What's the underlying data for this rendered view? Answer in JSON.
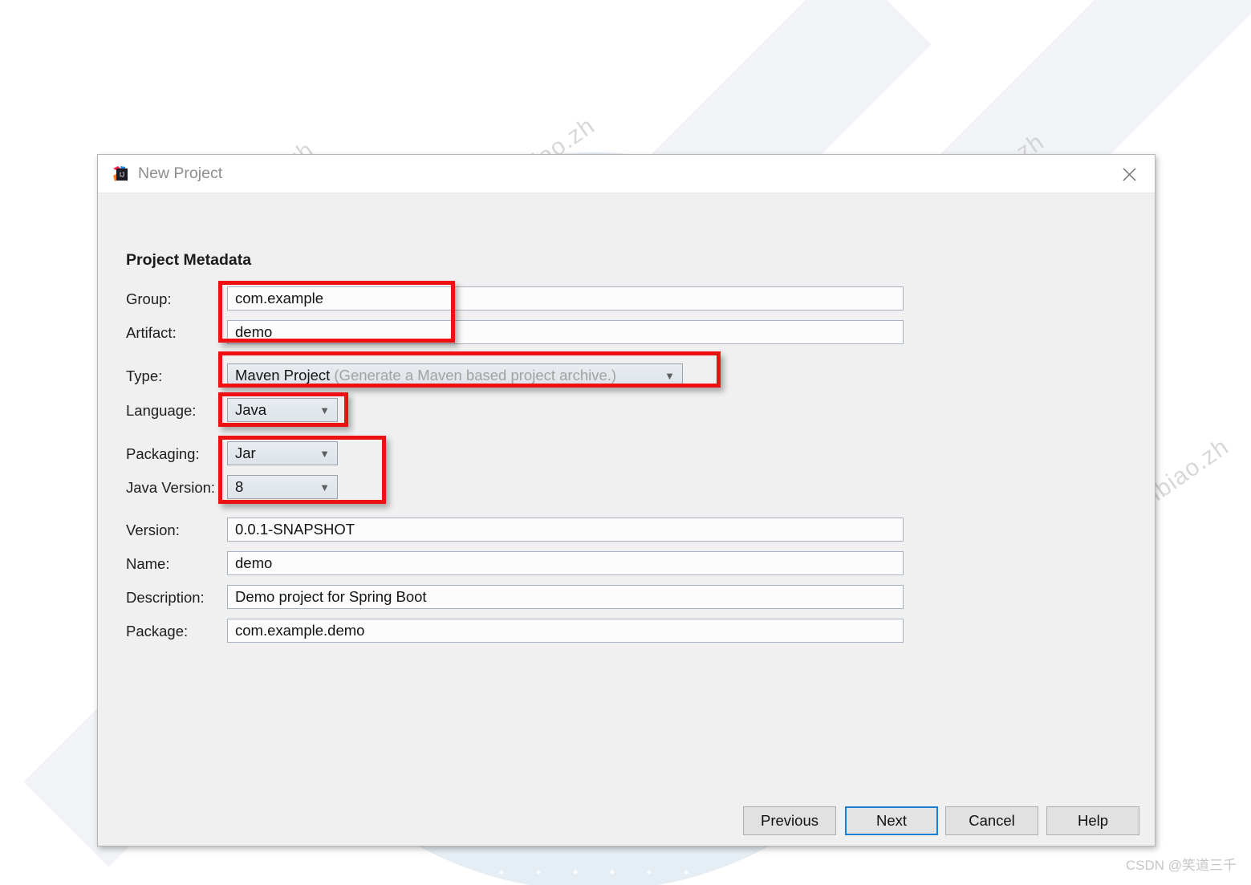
{
  "window": {
    "title": "New Project",
    "app_icon": "intellij-idea-icon",
    "close_icon": "close-icon"
  },
  "section": {
    "heading": "Project Metadata"
  },
  "fields": {
    "group": {
      "label": "Group:",
      "value": "com.example"
    },
    "artifact": {
      "label": "Artifact:",
      "value": "demo"
    },
    "type": {
      "label": "Type:",
      "value": "Maven Project",
      "hint": "(Generate a Maven based project archive.)"
    },
    "language": {
      "label": "Language:",
      "value": "Java"
    },
    "packaging": {
      "label": "Packaging:",
      "value": "Jar"
    },
    "java_version": {
      "label": "Java Version:",
      "value": "8"
    },
    "version": {
      "label": "Version:",
      "value": "0.0.1-SNAPSHOT"
    },
    "name": {
      "label": "Name:",
      "value": "demo"
    },
    "description": {
      "label": "Description:",
      "value": "Demo project for Spring Boot"
    },
    "package": {
      "label": "Package:",
      "value": "com.example.demo"
    }
  },
  "buttons": {
    "previous": "Previous",
    "next": "Next",
    "cancel": "Cancel",
    "help": "Help"
  },
  "watermarks": {
    "diagonal": "huangchuanbiao.zh",
    "footer": "CSDN @笑道三千"
  },
  "colors": {
    "annotation_red": "#ee1111",
    "default_button_border": "#1a7ed1",
    "dialog_background": "#f0f0f0",
    "watermark_blue": "#d7e3ef"
  }
}
